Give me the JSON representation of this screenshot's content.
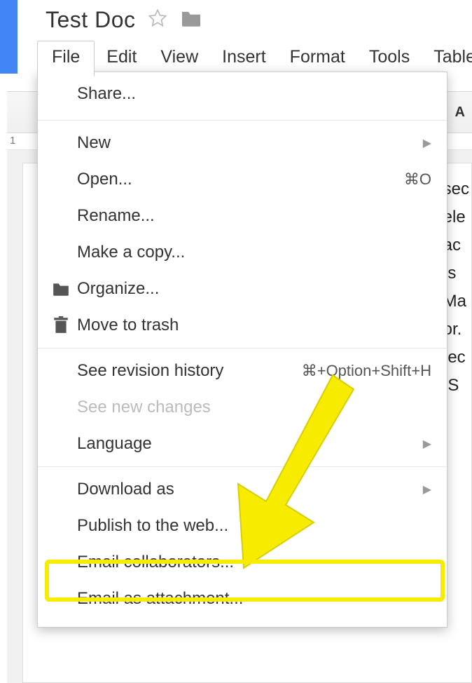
{
  "doc": {
    "title": "Test Doc",
    "body_lines": [
      " sec",
      " ele",
      "tac",
      "us",
      " Ma",
      "tor.",
      "nec",
      ". S"
    ]
  },
  "menu_bar": [
    "File",
    "Edit",
    "View",
    "Insert",
    "Format",
    "Tools",
    "Table"
  ],
  "toolbar": {
    "font_letter": "A"
  },
  "ruler": {
    "mark": "1"
  },
  "dropdown": {
    "share": "Share...",
    "new": "New",
    "open": "Open...",
    "open_shortcut": "⌘O",
    "rename": "Rename...",
    "make_copy": "Make a copy...",
    "organize": "Organize...",
    "trash": "Move to trash",
    "revision": "See revision history",
    "revision_shortcut": "⌘+Option+Shift+H",
    "new_changes": "See new changes",
    "language": "Language",
    "download": "Download as",
    "publish": "Publish to the web...",
    "email_collab": "Email collaborators...",
    "email_attach": "Email as attachment..."
  }
}
